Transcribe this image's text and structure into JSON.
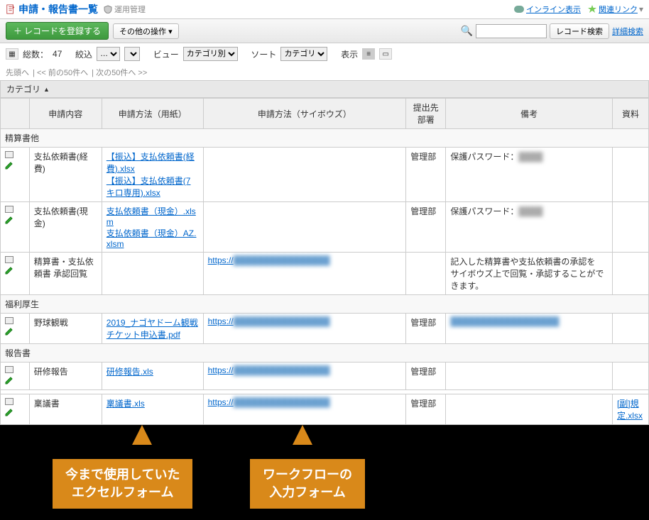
{
  "header": {
    "title": "申請・報告書一覧",
    "manage_label": "運用管理",
    "inline_view": "インライン表示",
    "related_links": "関連リンク"
  },
  "toolbar": {
    "add_record": "レコードを登録する",
    "other_ops": "その他の操作",
    "search_placeholder": "",
    "search_btn": "レコード検索",
    "detail_search": "詳細検索"
  },
  "filter": {
    "total_label": "総数：",
    "total_count": "47",
    "narrow_label": "絞込",
    "narrow_value": "…",
    "view_label": "ビュー",
    "view_value": "カテゴリ別",
    "sort_label": "ソート",
    "sort_value": "カテゴリ",
    "show_label": "表示"
  },
  "nav": {
    "first": "先頭へ",
    "prev": "<< 前の50件へ",
    "next": "次の50件へ >>"
  },
  "category_header": "カテゴリ",
  "columns": {
    "naiyo": "申請内容",
    "yoshi": "申請方法（用紙）",
    "cybozu": "申請方法（サイボウズ）",
    "busho": "提出先部署",
    "biko": "備考",
    "shiryo": "資料"
  },
  "groups": [
    {
      "label": "精算書他",
      "rows": [
        {
          "naiyo": "支払依頼書(経費)",
          "yoshi_links": [
            "【振込】支払依頼書(経費).xlsx",
            "【振込】支払依頼書(7キロ専用).xlsx"
          ],
          "cybozu": "",
          "busho": "管理部",
          "biko_text": "保護パスワード：",
          "biko_blur": "████",
          "shiryo": ""
        },
        {
          "naiyo": "支払依頼書(現金)",
          "yoshi_links": [
            "支払依頼書（現金）.xlsm",
            "支払依頼書（現金）AZ.xlsm"
          ],
          "cybozu": "",
          "busho": "管理部",
          "biko_text": "保護パスワード：",
          "biko_blur": "████",
          "shiryo": ""
        },
        {
          "naiyo": "精算書・支払依頼書 承認回覧",
          "yoshi_links": [],
          "cybozu": "https://",
          "cybozu_blur": "████████████████",
          "busho": "",
          "biko_text": "記入した精算書や支払依頼書の承認を\nサイボウズ上で回覧・承認することができます。",
          "shiryo": ""
        }
      ]
    },
    {
      "label": "福利厚生",
      "rows": [
        {
          "naiyo": "野球観戦",
          "yoshi_links": [
            "2019_ナゴヤドーム観戦チケット申込書.pdf"
          ],
          "cybozu": "https://",
          "cybozu_blur": "████████████████",
          "busho": "管理部",
          "biko_blur_full": "██████████████████",
          "shiryo": ""
        }
      ]
    },
    {
      "label": "報告書",
      "rows": [
        {
          "naiyo": "研修報告",
          "yoshi_links": [
            "研修報告.xls"
          ],
          "cybozu": "https://",
          "cybozu_blur": "████████████████",
          "busho": "管理部",
          "biko_text": "",
          "shiryo": ""
        },
        {
          "spacer": true
        },
        {
          "naiyo": "稟議書",
          "yoshi_links": [
            "稟議書.xls"
          ],
          "cybozu": "https://",
          "cybozu_blur": "████████████████",
          "busho": "管理部",
          "biko_text": "",
          "shiryo_link": "[副]規定.xlsx"
        }
      ]
    }
  ],
  "callouts": {
    "left": "今まで使用していた\nエクセルフォーム",
    "right": "ワークフローの\n入力フォーム"
  }
}
